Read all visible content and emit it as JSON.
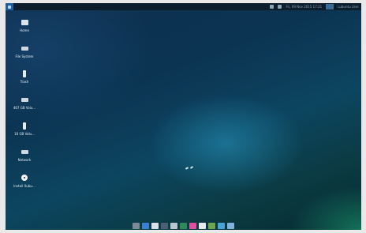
{
  "top_panel": {
    "clock": "Fri, 09 Nov 2015 17:21",
    "user": "Lubuntu User"
  },
  "desktop_icons": [
    {
      "label": "Home",
      "icon": "folder-home-icon"
    },
    {
      "label": "File System",
      "icon": "drive-icon"
    },
    {
      "label": "Trash",
      "icon": "trash-icon"
    },
    {
      "label": "467 GB Volu...",
      "icon": "drive-icon"
    },
    {
      "label": "16 GB Volu...",
      "icon": "usb-drive-icon"
    },
    {
      "label": "Network",
      "icon": "network-drive-icon"
    },
    {
      "label": "Install Xubu...",
      "icon": "install-disc-icon"
    }
  ],
  "dock": [
    {
      "name": "show-desktop-icon",
      "color": "#7c8a98"
    },
    {
      "name": "browser-icon",
      "color": "#3b7fd0"
    },
    {
      "name": "mail-icon",
      "color": "#d9e1e8"
    },
    {
      "name": "media-player-icon",
      "color": "#4a5f74"
    },
    {
      "name": "photo-viewer-icon",
      "color": "#b8c6d2"
    },
    {
      "name": "terminal-icon",
      "color": "#2f8a5a"
    },
    {
      "name": "music-icon",
      "color": "#e04fa0"
    },
    {
      "name": "document-icon",
      "color": "#e6eaee"
    },
    {
      "name": "software-icon",
      "color": "#6aa84f"
    },
    {
      "name": "image-editor-icon",
      "color": "#4aa3d8"
    },
    {
      "name": "files-icon",
      "color": "#7fb2dc"
    }
  ]
}
